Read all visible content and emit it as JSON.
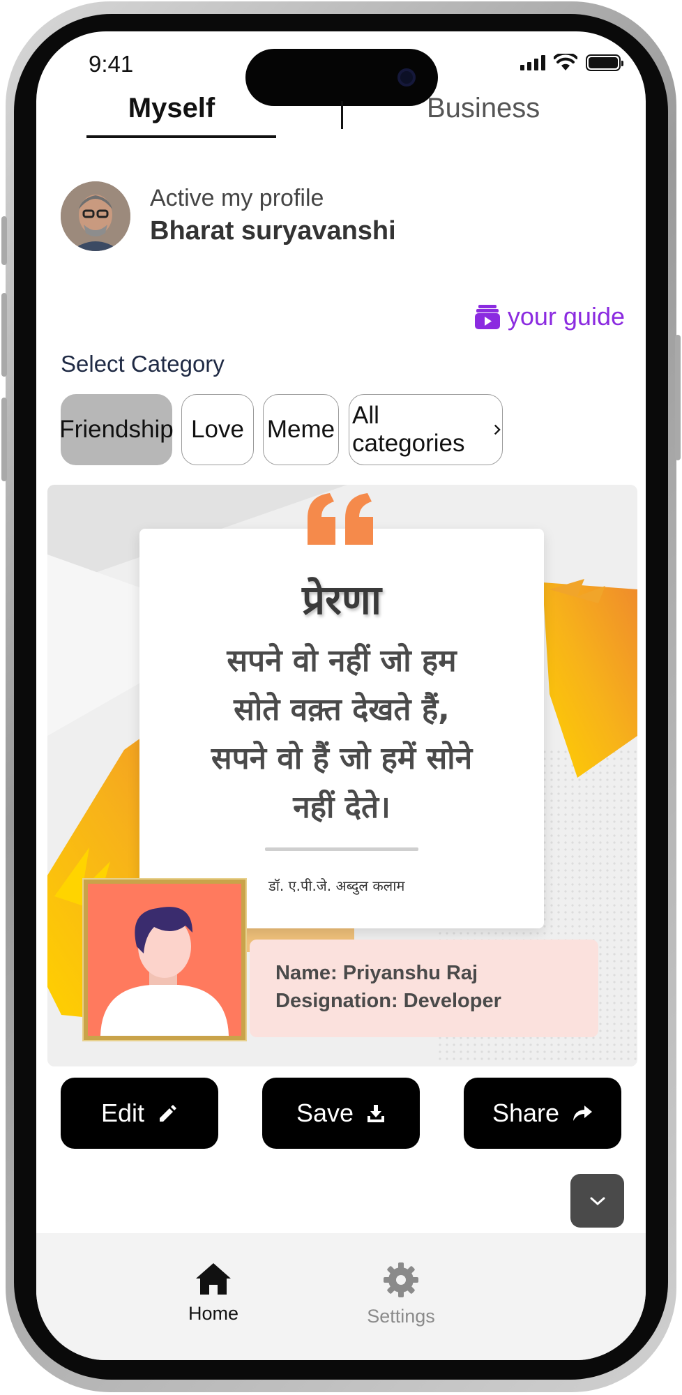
{
  "status_bar": {
    "time": "9:41"
  },
  "tabs": {
    "active": "Myself",
    "inactive": "Business"
  },
  "profile": {
    "subtitle": "Active my profile",
    "name": "Bharat suryavanshi"
  },
  "guide": {
    "label": "your guide",
    "icon": "video-guide-icon",
    "color": "#8b2be0"
  },
  "category": {
    "title": "Select Category",
    "chips": [
      "Friendship",
      "Love",
      "Meme",
      "All categories"
    ]
  },
  "card": {
    "quote_title": "प्रेरणा",
    "quote_lines": [
      "सपने वो नहीं जो हम",
      "सोते वक़्त देखते हैं,",
      "सपने वो हैं जो हमें सोने",
      "नहीं देते।"
    ],
    "author": "डॉ. ए.पी.जे. अब्दुल कलाम",
    "person": {
      "name_line": "Name: Priyanshu Raj",
      "designation_line": "Designation: Developer"
    },
    "accent_color": "#f58a4b"
  },
  "actions": {
    "edit": "Edit",
    "save": "Save",
    "share": "Share"
  },
  "bottom_nav": {
    "home": "Home",
    "settings": "Settings"
  }
}
